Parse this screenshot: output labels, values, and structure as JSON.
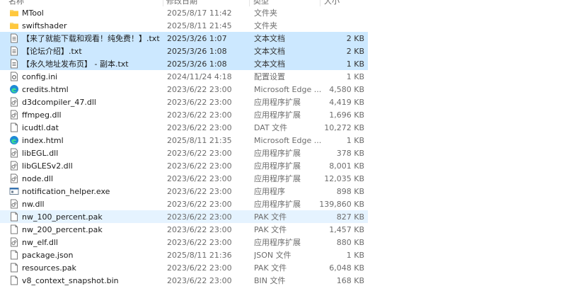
{
  "header": {
    "columns": [
      "名称",
      "修改日期",
      "类型",
      "大小"
    ]
  },
  "files": [
    {
      "name": "MTool",
      "date": "2025/8/17 11:42",
      "type": "文件夹",
      "size": "",
      "icon": "folder",
      "state": ""
    },
    {
      "name": "swiftshader",
      "date": "2025/8/11 21:45",
      "type": "文件夹",
      "size": "",
      "icon": "folder",
      "state": ""
    },
    {
      "name": "【来了就能下载和观看！纯免费！】.txt",
      "date": "2025/3/26 1:07",
      "type": "文本文档",
      "size": "2 KB",
      "icon": "text",
      "state": "selected"
    },
    {
      "name": "【论坛介绍】.txt",
      "date": "2025/3/26 1:08",
      "type": "文本文档",
      "size": "2 KB",
      "icon": "text",
      "state": "selected"
    },
    {
      "name": "【永久地址发布页】 - 副本.txt",
      "date": "2025/3/26 1:08",
      "type": "文本文档",
      "size": "1 KB",
      "icon": "text",
      "state": "selected"
    },
    {
      "name": "config.ini",
      "date": "2024/11/24 4:18",
      "type": "配置设置",
      "size": "1 KB",
      "icon": "config",
      "state": ""
    },
    {
      "name": "credits.html",
      "date": "2023/6/22 23:00",
      "type": "Microsoft Edge ...",
      "size": "4,580 KB",
      "icon": "edge",
      "state": ""
    },
    {
      "name": "d3dcompiler_47.dll",
      "date": "2023/6/22 23:00",
      "type": "应用程序扩展",
      "size": "4,419 KB",
      "icon": "dll",
      "state": ""
    },
    {
      "name": "ffmpeg.dll",
      "date": "2023/6/22 23:00",
      "type": "应用程序扩展",
      "size": "1,696 KB",
      "icon": "dll",
      "state": ""
    },
    {
      "name": "icudtl.dat",
      "date": "2023/6/22 23:00",
      "type": "DAT 文件",
      "size": "10,272 KB",
      "icon": "file",
      "state": ""
    },
    {
      "name": "index.html",
      "date": "2025/8/11 21:35",
      "type": "Microsoft Edge ...",
      "size": "1 KB",
      "icon": "edge",
      "state": ""
    },
    {
      "name": "libEGL.dll",
      "date": "2023/6/22 23:00",
      "type": "应用程序扩展",
      "size": "378 KB",
      "icon": "dll",
      "state": ""
    },
    {
      "name": "libGLESv2.dll",
      "date": "2023/6/22 23:00",
      "type": "应用程序扩展",
      "size": "8,001 KB",
      "icon": "dll",
      "state": ""
    },
    {
      "name": "node.dll",
      "date": "2023/6/22 23:00",
      "type": "应用程序扩展",
      "size": "12,035 KB",
      "icon": "dll",
      "state": ""
    },
    {
      "name": "notification_helper.exe",
      "date": "2023/6/22 23:00",
      "type": "应用程序",
      "size": "898 KB",
      "icon": "exe",
      "state": ""
    },
    {
      "name": "nw.dll",
      "date": "2023/6/22 23:00",
      "type": "应用程序扩展",
      "size": "139,860 KB",
      "icon": "dll",
      "state": ""
    },
    {
      "name": "nw_100_percent.pak",
      "date": "2023/6/22 23:00",
      "type": "PAK 文件",
      "size": "827 KB",
      "icon": "file",
      "state": "hover"
    },
    {
      "name": "nw_200_percent.pak",
      "date": "2023/6/22 23:00",
      "type": "PAK 文件",
      "size": "1,457 KB",
      "icon": "file",
      "state": ""
    },
    {
      "name": "nw_elf.dll",
      "date": "2023/6/22 23:00",
      "type": "应用程序扩展",
      "size": "880 KB",
      "icon": "dll",
      "state": ""
    },
    {
      "name": "package.json",
      "date": "2025/8/11 21:36",
      "type": "JSON 文件",
      "size": "1 KB",
      "icon": "file",
      "state": ""
    },
    {
      "name": "resources.pak",
      "date": "2023/6/22 23:00",
      "type": "PAK 文件",
      "size": "6,048 KB",
      "icon": "file",
      "state": ""
    },
    {
      "name": "v8_context_snapshot.bin",
      "date": "2023/6/22 23:00",
      "type": "BIN 文件",
      "size": "168 KB",
      "icon": "file",
      "state": ""
    }
  ]
}
